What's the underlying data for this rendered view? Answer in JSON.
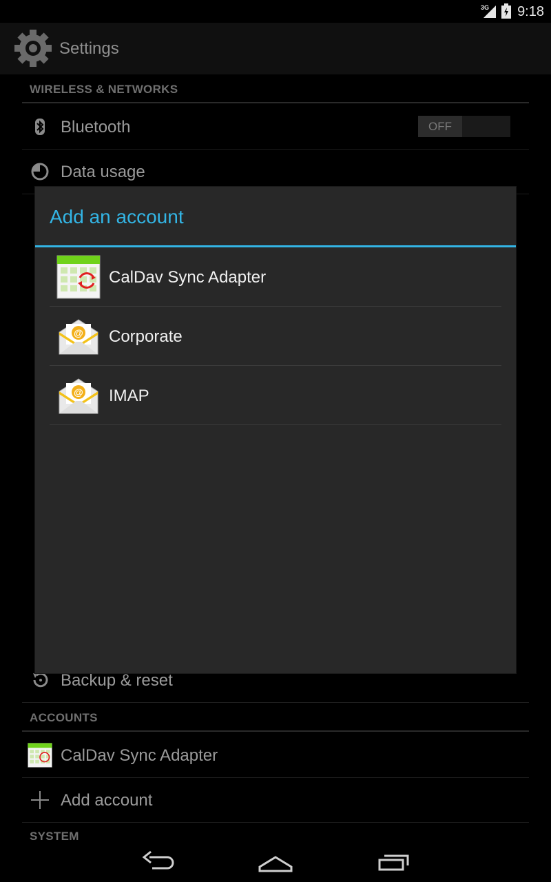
{
  "status": {
    "network": "3G",
    "time": "9:18"
  },
  "app": {
    "title": "Settings"
  },
  "sections": {
    "wireless": "WIRELESS & NETWORKS",
    "accounts": "ACCOUNTS",
    "system": "SYSTEM"
  },
  "settings_rows": {
    "bluetooth": "Bluetooth",
    "bluetooth_toggle": "OFF",
    "data_usage": "Data usage",
    "backup": "Backup & reset",
    "caldav_account": "CalDav Sync Adapter",
    "add_account": "Add account"
  },
  "dialog": {
    "title": "Add an account",
    "items": [
      {
        "label": "CalDav Sync Adapter",
        "icon": "calendar-sync-icon"
      },
      {
        "label": "Corporate",
        "icon": "email-envelope-icon"
      },
      {
        "label": "IMAP",
        "icon": "email-envelope-icon"
      }
    ]
  },
  "navbar": {
    "back": "back-icon",
    "home": "home-icon",
    "recents": "recents-icon"
  },
  "colors": {
    "accent": "#33b5e5",
    "dialog_bg": "#282828",
    "background": "#000000"
  }
}
